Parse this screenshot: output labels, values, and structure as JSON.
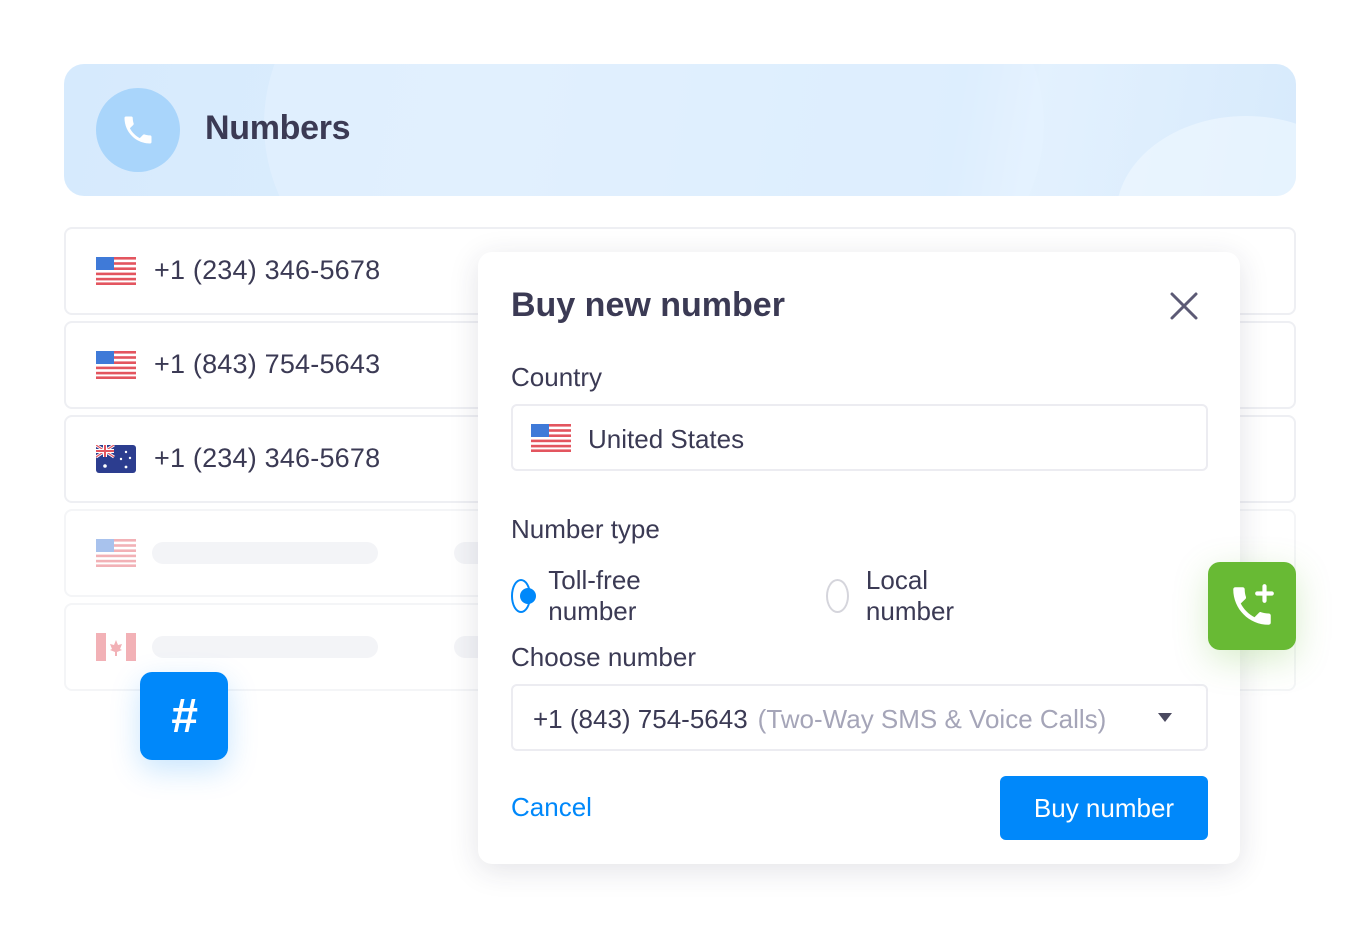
{
  "header": {
    "title": "Numbers",
    "icon": "phone-icon"
  },
  "numbers_list": [
    {
      "flag": "us-flag",
      "number": "+1 (234) 346-5678"
    },
    {
      "flag": "us-flag",
      "number": "+1 (843) 754-5643"
    },
    {
      "flag": "au-flag",
      "number": "+1 (234) 346-5678"
    },
    {
      "flag": "us-flag",
      "number": null,
      "loading": true
    },
    {
      "flag": "ca-flag",
      "number": null,
      "loading": true
    }
  ],
  "floating_buttons": {
    "hash_icon": "hash-icon",
    "hash_glyph": "#",
    "add_call_icon": "phone-plus-icon"
  },
  "modal": {
    "title": "Buy new number",
    "close_icon": "close-icon",
    "country_label": "Country",
    "country_value": "United States",
    "country_flag": "us-flag",
    "number_type_label": "Number type",
    "number_type_options": [
      {
        "label": "Toll-free number",
        "selected": true
      },
      {
        "label": "Local number",
        "selected": false
      }
    ],
    "choose_number_label": "Choose number",
    "choose_number_value": "+1 (843) 754-5643",
    "choose_number_hint": "(Two-Way SMS & Voice Calls)",
    "cancel_label": "Cancel",
    "buy_label": "Buy number"
  },
  "colors": {
    "accent": "#0088fa",
    "success": "#68ba34",
    "text": "#3b3a54",
    "muted": "#a5a5b8",
    "header_bg": "#d6eafd"
  }
}
